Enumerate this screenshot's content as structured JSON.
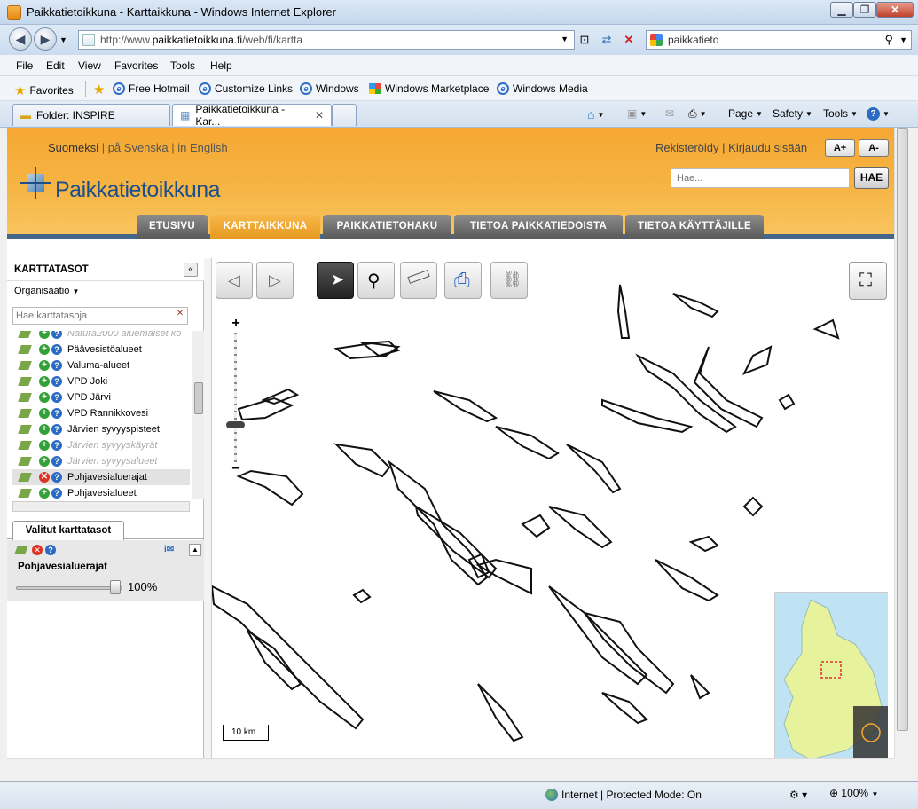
{
  "window": {
    "title": "Paikkatietoikkuna - Karttaikkuna - Windows Internet Explorer"
  },
  "browser": {
    "url_prefix": "http://www.",
    "url_host": "paikkatietoikkuna.fi",
    "url_path": "/web/fi/kartta",
    "search_value": "paikkatieto",
    "menu": [
      "File",
      "Edit",
      "View",
      "Favorites",
      "Tools",
      "Help"
    ],
    "favorites_label": "Favorites",
    "favorite_links": [
      "Free Hotmail",
      "Customize Links",
      "Windows",
      "Windows Marketplace",
      "Windows Media"
    ],
    "tabs": [
      {
        "label": "Folder: INSPIRE"
      },
      {
        "label": "Paikkatietoikkuna - Kar..."
      }
    ],
    "commands": {
      "page": "Page",
      "safety": "Safety",
      "tools": "Tools"
    },
    "status_zone": "Internet | Protected Mode: On",
    "status_zoom": "100%"
  },
  "site": {
    "lang_current": "Suomeksi",
    "lang_sv": "på Svenska",
    "lang_en": "in English",
    "register": "Rekisteröidy",
    "login": "Kirjaudu sisään",
    "font_larger": "A+",
    "font_smaller": "A-",
    "logo": "Paikkatietoikkuna",
    "search_placeholder": "Hae...",
    "search_button": "HAE",
    "nav": [
      "ETUSIVU",
      "KARTTAIKKUNA",
      "PAIKKATIETOHAKU",
      "TIETOA PAIKKATIEDOISTA",
      "TIETOA KÄYTTÄJILLE"
    ]
  },
  "sidebar": {
    "title": "KARTTATASOT",
    "collapse": "«",
    "org_label": "Organisaatio",
    "layer_search_placeholder": "Hae karttatasoja",
    "layers": [
      {
        "name": "Natura2000 aluemaiset ko",
        "disabled": true
      },
      {
        "name": "Päävesistöalueet",
        "disabled": false
      },
      {
        "name": "Valuma-alueet",
        "disabled": false
      },
      {
        "name": "VPD Joki",
        "disabled": false
      },
      {
        "name": "VPD Järvi",
        "disabled": false
      },
      {
        "name": "VPD Rannikkovesi",
        "disabled": false
      },
      {
        "name": "Järvien syvyyspisteet",
        "disabled": false
      },
      {
        "name": "Järvien syvyyskäyrät",
        "disabled": true
      },
      {
        "name": "Järvien syvyysalueet",
        "disabled": true
      },
      {
        "name": "Pohjavesialuerajat",
        "disabled": false,
        "selected": true
      },
      {
        "name": "Pohjavesialueet",
        "disabled": false
      }
    ],
    "selected_tab": "Valitut karttatasot",
    "selected_layer": "Pohjavesialuerajat",
    "opacity": "100%"
  },
  "map": {
    "scale_label": "10 km",
    "zoom_in": "+",
    "zoom_out": "−"
  }
}
